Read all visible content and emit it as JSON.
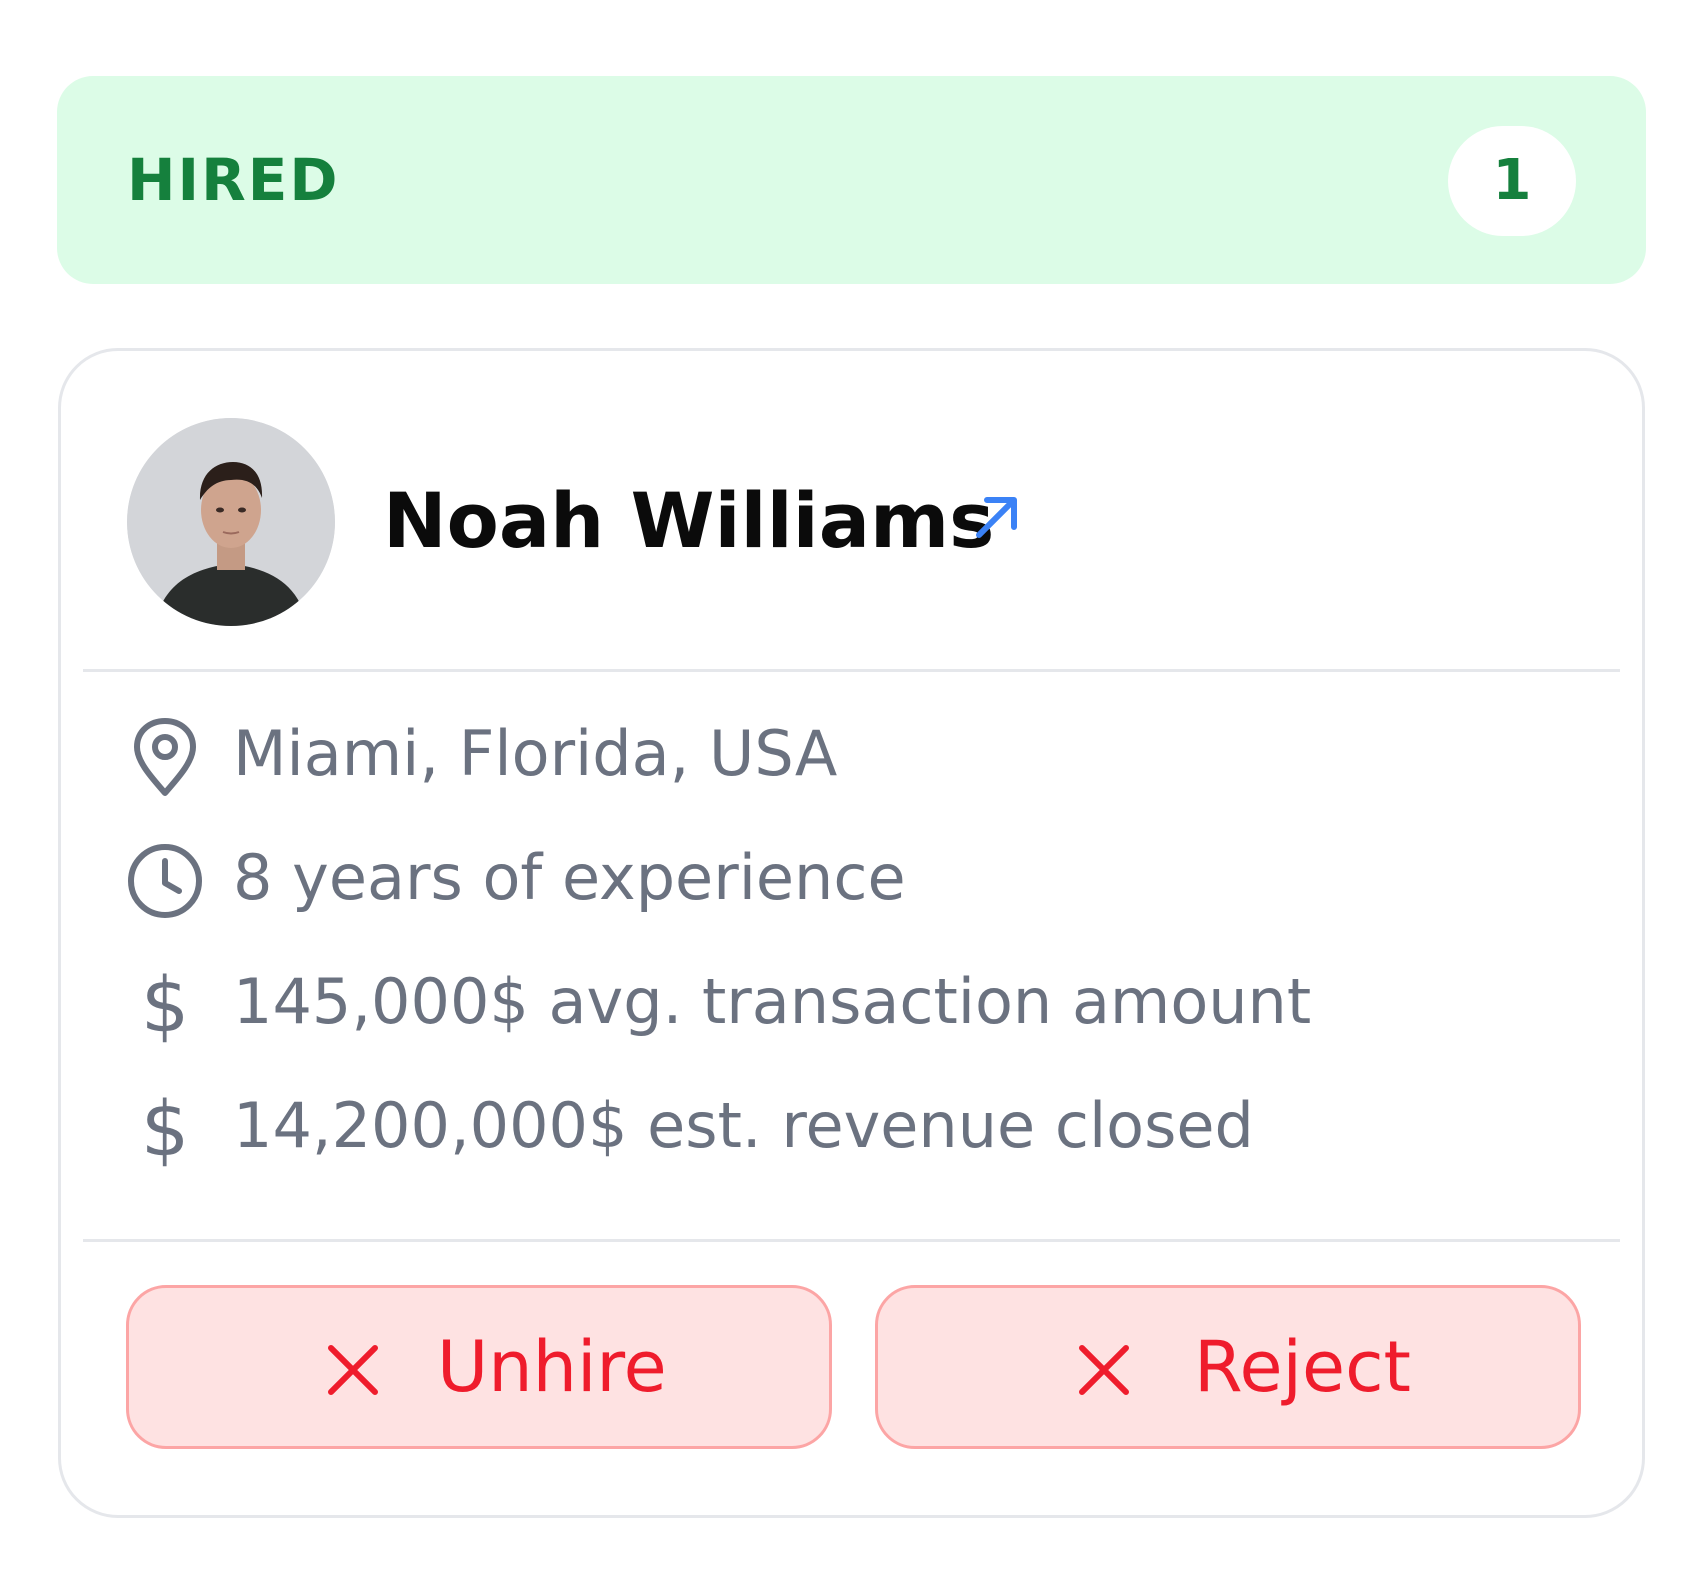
{
  "column": {
    "title": "HIRED",
    "count": "1",
    "accent_bg": "#dcfce7",
    "accent_fg": "#15803d"
  },
  "candidate": {
    "name": "Noah Williams",
    "avatar_icon": "person-photo",
    "link_icon": "external-link-arrow-icon",
    "details": [
      {
        "icon": "map-pin-icon",
        "text": "Miami, Florida, USA"
      },
      {
        "icon": "clock-icon",
        "text": "8 years of experience"
      },
      {
        "icon": "dollar-icon",
        "text": "145,000$ avg. transaction amount"
      },
      {
        "icon": "dollar-icon",
        "text": "14,200,000$ est. revenue closed"
      }
    ]
  },
  "actions": {
    "unhire_label": "Unhire",
    "reject_label": "Reject",
    "danger_color": "#ef1c2c"
  }
}
